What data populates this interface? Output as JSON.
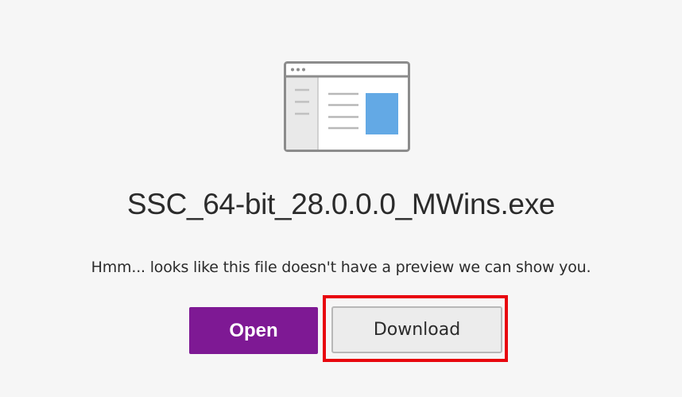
{
  "preview": {
    "file_name": "SSC_64-bit_28.0.0.0_MWins.exe",
    "message": "Hmm... looks like this file doesn't have a preview we can show you.",
    "illustration_icon": "file-preview-placeholder-icon"
  },
  "actions": {
    "open_label": "Open",
    "download_label": "Download"
  },
  "colors": {
    "background": "#f6f6f6",
    "open_button": "#7e1994",
    "download_button": "#ececec",
    "highlight_box": "#e8060e"
  }
}
